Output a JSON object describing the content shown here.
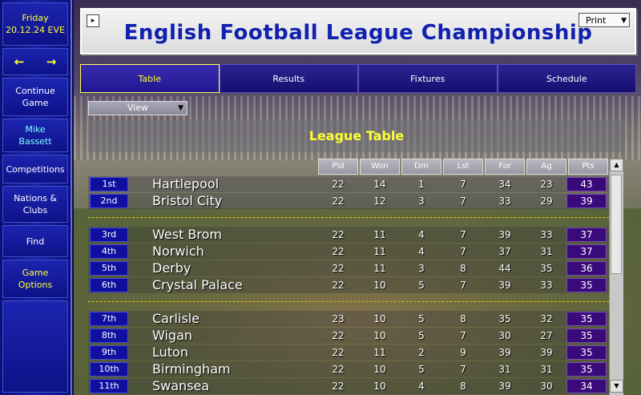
{
  "sidebar": {
    "day": "Friday",
    "date": "20.12.24 EVE",
    "left_arrow": "←",
    "right_arrow": "→",
    "continue": "Continue Game",
    "manager": "Mike Bassett",
    "competitions": "Competitions",
    "nations": "Nations & Clubs",
    "find": "Find",
    "options": "Game Options"
  },
  "header": {
    "title": "English Football League Championship",
    "expand": "▸",
    "print_label": "Print"
  },
  "tabs": [
    {
      "label": "Table",
      "active": true
    },
    {
      "label": "Results",
      "active": false
    },
    {
      "label": "Fixtures",
      "active": false
    },
    {
      "label": "Schedule",
      "active": false
    }
  ],
  "view_label": "View",
  "league_title": "League Table",
  "columns": [
    "Pld",
    "Won",
    "Drn",
    "Lst",
    "For",
    "Ag",
    "Pts"
  ],
  "rows": [
    {
      "pos": "1st",
      "team": "Hartlepool",
      "pld": "22",
      "won": "14",
      "drn": "1",
      "lst": "7",
      "for": "34",
      "ag": "23",
      "pts": "43"
    },
    {
      "pos": "2nd",
      "team": "Bristol City",
      "pld": "22",
      "won": "12",
      "drn": "3",
      "lst": "7",
      "for": "33",
      "ag": "29",
      "pts": "39"
    },
    {
      "pos": "3rd",
      "team": "West Brom",
      "pld": "22",
      "won": "11",
      "drn": "4",
      "lst": "7",
      "for": "39",
      "ag": "33",
      "pts": "37"
    },
    {
      "pos": "4th",
      "team": "Norwich",
      "pld": "22",
      "won": "11",
      "drn": "4",
      "lst": "7",
      "for": "37",
      "ag": "31",
      "pts": "37"
    },
    {
      "pos": "5th",
      "team": "Derby",
      "pld": "22",
      "won": "11",
      "drn": "3",
      "lst": "8",
      "for": "44",
      "ag": "35",
      "pts": "36"
    },
    {
      "pos": "6th",
      "team": "Crystal Palace",
      "pld": "22",
      "won": "10",
      "drn": "5",
      "lst": "7",
      "for": "39",
      "ag": "33",
      "pts": "35"
    },
    {
      "pos": "7th",
      "team": "Carlisle",
      "pld": "23",
      "won": "10",
      "drn": "5",
      "lst": "8",
      "for": "35",
      "ag": "32",
      "pts": "35"
    },
    {
      "pos": "8th",
      "team": "Wigan",
      "pld": "22",
      "won": "10",
      "drn": "5",
      "lst": "7",
      "for": "30",
      "ag": "27",
      "pts": "35"
    },
    {
      "pos": "9th",
      "team": "Luton",
      "pld": "22",
      "won": "11",
      "drn": "2",
      "lst": "9",
      "for": "39",
      "ag": "39",
      "pts": "35"
    },
    {
      "pos": "10th",
      "team": "Birmingham",
      "pld": "22",
      "won": "10",
      "drn": "5",
      "lst": "7",
      "for": "31",
      "ag": "31",
      "pts": "35"
    },
    {
      "pos": "11th",
      "team": "Swansea",
      "pld": "22",
      "won": "10",
      "drn": "4",
      "lst": "8",
      "for": "39",
      "ag": "30",
      "pts": "34"
    }
  ],
  "scroll": {
    "up": "▲",
    "down": "▼"
  }
}
